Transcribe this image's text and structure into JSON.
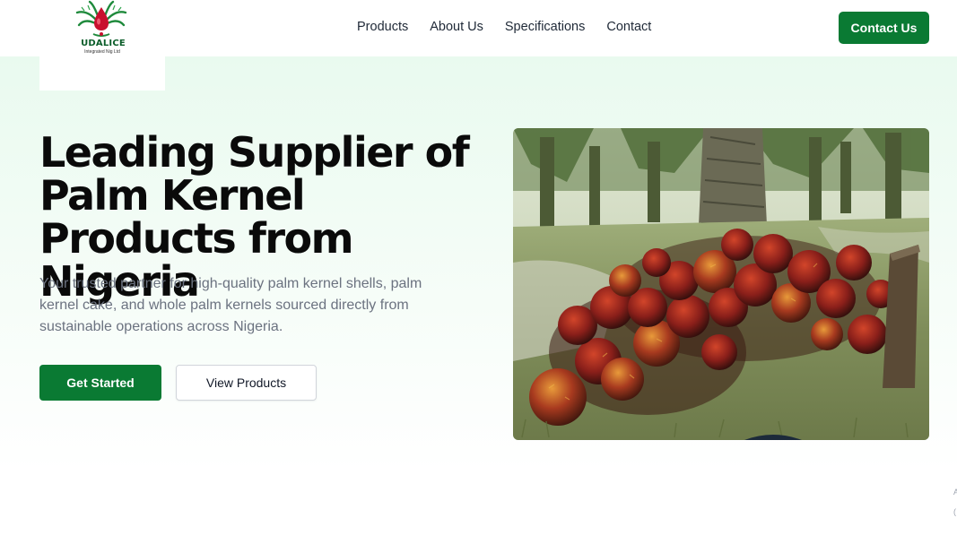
{
  "brand": {
    "name": "UDALICE",
    "tagline": "Integrated Nig Ltd",
    "colors": {
      "primary": "#0a7a33",
      "logo_red": "#c8102e",
      "logo_green": "#1f8a3c"
    },
    "logo_icon": "palm-oil-drop-logo"
  },
  "nav": {
    "items": [
      {
        "label": "Products"
      },
      {
        "label": "About Us"
      },
      {
        "label": "Specifications"
      },
      {
        "label": "Contact"
      }
    ],
    "cta_label": "Contact Us"
  },
  "hero": {
    "title": "Leading Supplier of Palm Kernel Products from Nigeria",
    "description": "Your trusted partner for high-quality palm kernel shells, palm kernel cake, and whole palm kernels sourced directly from sustainable operations across Nigeria.",
    "primary_button": "Get Started",
    "secondary_button": "View Products",
    "image_subject": "palm-fruit-bunches-photo"
  },
  "edge": {
    "glyph1": "A",
    "glyph2": "("
  }
}
